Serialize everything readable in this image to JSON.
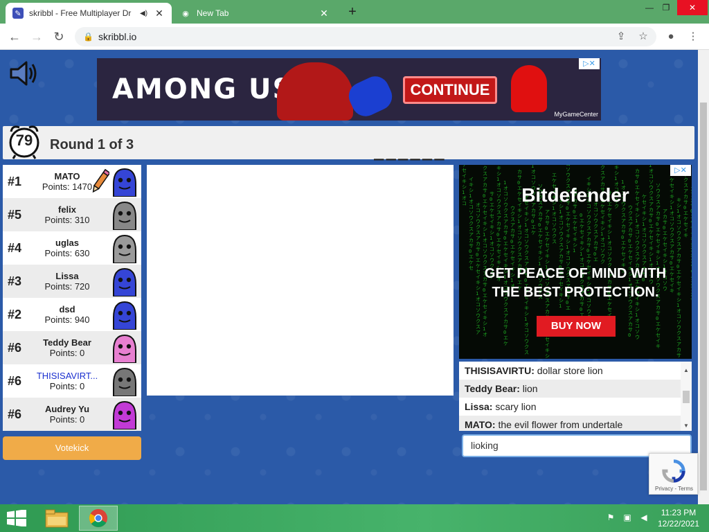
{
  "browser": {
    "tabs": [
      {
        "title": "skribbl - Free Multiplayer Dr",
        "active": true
      },
      {
        "title": "New Tab",
        "active": false
      }
    ],
    "url": "skribbl.io",
    "window_controls": {
      "minimize": "—",
      "restore": "❐",
      "close": "✕"
    }
  },
  "ads": {
    "top": {
      "logo": "AMONG US",
      "cta": "CONTINUE",
      "brand": "MyGameCenter",
      "adchoices": "▷✕"
    },
    "right": {
      "brand": "Bitdefender",
      "headline_line1": "GET PEACE OF MIND WITH",
      "headline_line2": "THE BEST PROTECTION.",
      "cta": "BUY NOW",
      "adchoices": "▷✕"
    }
  },
  "game": {
    "timer": "79",
    "round_label": "Round 1 of 3",
    "word_hint": "______"
  },
  "players": [
    {
      "rank": "#1",
      "name": "MATO",
      "points": "Points: 1470",
      "color": "#3545d6",
      "drawing": true
    },
    {
      "rank": "#5",
      "name": "felix",
      "points": "Points: 310",
      "color": "#888888"
    },
    {
      "rank": "#4",
      "name": "uglas",
      "points": "Points: 630",
      "color": "#9a9a9a"
    },
    {
      "rank": "#3",
      "name": "Lissa",
      "points": "Points: 720",
      "color": "#3545d6"
    },
    {
      "rank": "#2",
      "name": "dsd",
      "points": "Points: 940",
      "color": "#3545d6"
    },
    {
      "rank": "#6",
      "name": "Teddy Bear",
      "points": "Points: 0",
      "color": "#e77fd0"
    },
    {
      "rank": "#6",
      "name": "THISISAVIRT...",
      "points": "Points: 0",
      "color": "#777777",
      "self": true
    },
    {
      "rank": "#6",
      "name": "Audrey Yu",
      "points": "Points: 0",
      "color": "#c23ad6"
    }
  ],
  "votekick_label": "Votekick",
  "chat": {
    "messages": [
      {
        "user": "THISISAVIRTU:",
        "text": " dollar store lion"
      },
      {
        "user": "Teddy Bear:",
        "text": " lion"
      },
      {
        "user": "Lissa:",
        "text": " scary lion"
      },
      {
        "user": "MATO:",
        "text": " the evil flower from undertale"
      }
    ],
    "input_value": "lioking"
  },
  "recaptcha": {
    "text": "Privacy - Terms"
  },
  "taskbar": {
    "time": "11:23 PM",
    "date": "12/22/2021"
  }
}
